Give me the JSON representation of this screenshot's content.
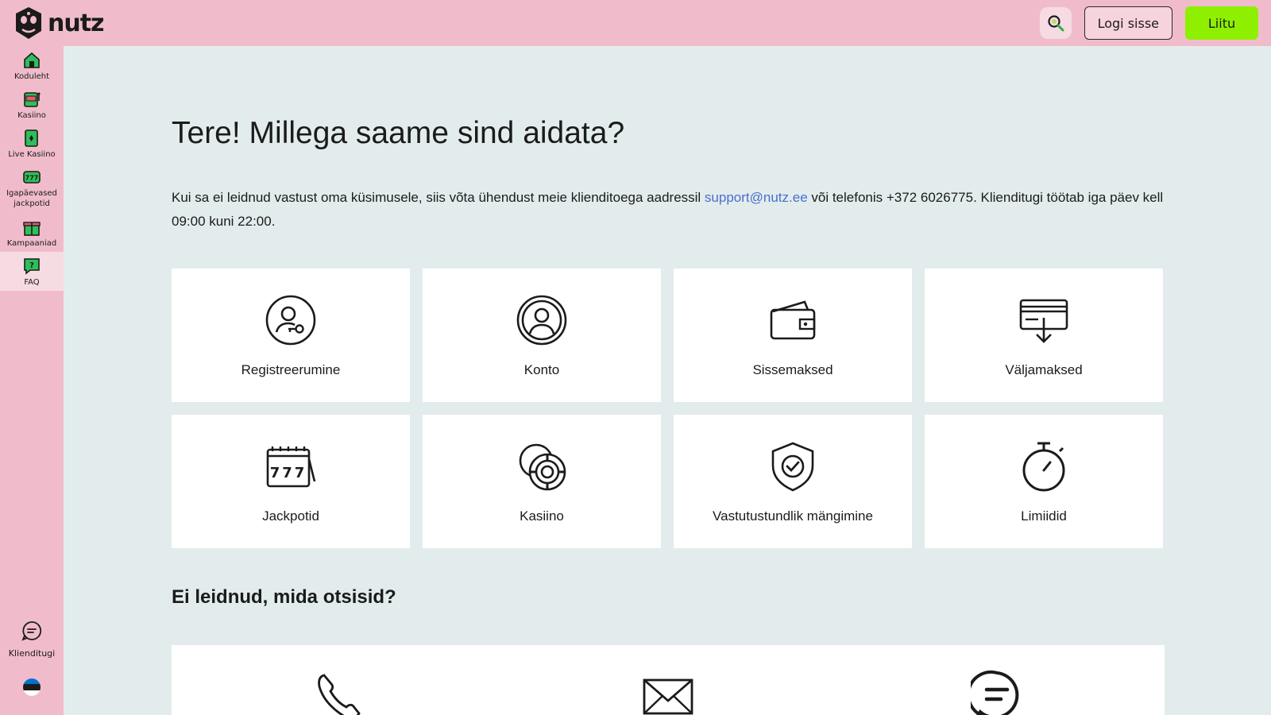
{
  "header": {
    "brand": "nutz",
    "login_label": "Logi sisse",
    "join_label": "Liitu",
    "colors": {
      "background": "#f0bccb",
      "join": "#8ef000"
    }
  },
  "sidebar": {
    "items": [
      {
        "label": "Koduleht",
        "icon": "home-icon"
      },
      {
        "label": "Kasiino",
        "icon": "slot-machine-icon"
      },
      {
        "label": "Live Kasiino",
        "icon": "live-card-icon"
      },
      {
        "label": "Igapäevased jackpotid",
        "icon": "jackpot-icon"
      },
      {
        "label": "Kampaaniad",
        "icon": "gift-icon"
      },
      {
        "label": "FAQ",
        "icon": "faq-icon"
      }
    ],
    "support_label": "Klienditugi"
  },
  "main": {
    "title": "Tere! Millega saame sind aidata?",
    "intro_before": "Kui sa ei leidnud vastust oma küsimusele, siis võta ühendust meie klienditoega aadressil ",
    "intro_email": "support@nutz.ee",
    "intro_after": " või telefonis +372 6026775. Klienditugi töötab iga päev kell 09:00 kuni 22:00.",
    "categories": [
      {
        "label": "Registreerumine",
        "icon": "user-key-icon"
      },
      {
        "label": "Konto",
        "icon": "account-icon"
      },
      {
        "label": "Sissemaksed",
        "icon": "wallet-icon"
      },
      {
        "label": "Väljamaksed",
        "icon": "withdraw-card-icon"
      },
      {
        "label": "Jackpotid",
        "icon": "jackpot-777-icon"
      },
      {
        "label": "Kasiino",
        "icon": "casino-chips-icon"
      },
      {
        "label": "Vastutustundlik mängimine",
        "icon": "shield-check-icon"
      },
      {
        "label": "Limiidid",
        "icon": "stopwatch-icon"
      }
    ],
    "not_found_title": "Ei leidnud, mida otsisid?"
  }
}
